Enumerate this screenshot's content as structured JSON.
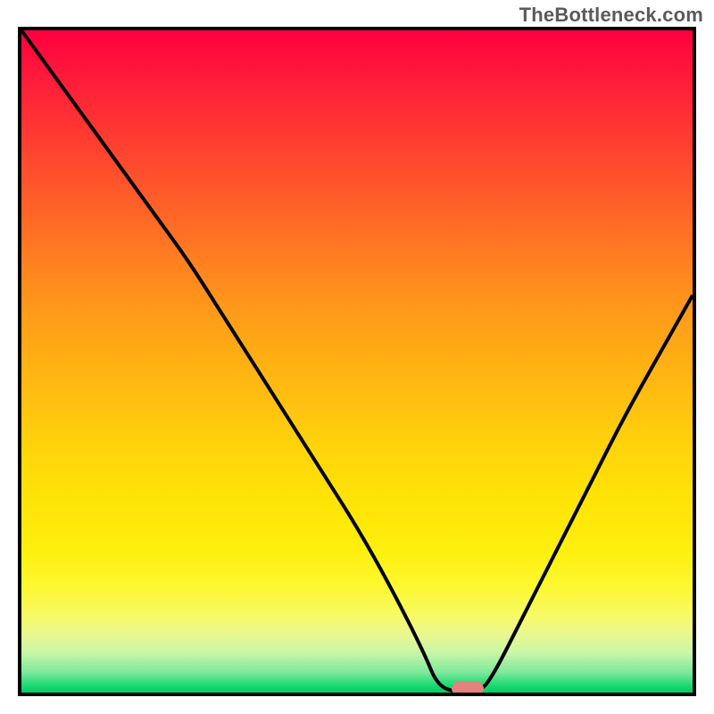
{
  "watermark": "TheBottleneck.com",
  "colors": {
    "frame_border": "#000000",
    "curve": "#000000",
    "marker": "#e5817f",
    "gradient_top": "#ff0040",
    "gradient_bottom": "#00cc66"
  },
  "chart_data": {
    "type": "line",
    "title": "",
    "xlabel": "",
    "ylabel": "",
    "xlim": [
      0,
      100
    ],
    "ylim": [
      0,
      100
    ],
    "x": [
      0,
      5,
      10,
      15,
      20,
      25,
      30,
      35,
      40,
      45,
      50,
      55,
      60,
      62,
      65,
      68,
      70,
      75,
      80,
      85,
      90,
      95,
      100
    ],
    "values": [
      100,
      93,
      86,
      79,
      72,
      65,
      57,
      49,
      41,
      33,
      25,
      16,
      6,
      1,
      0,
      0,
      2,
      12,
      22,
      32,
      42,
      51,
      60
    ],
    "marker": {
      "x": 66.5,
      "y": 0
    },
    "grid": false,
    "legend": null,
    "annotations": []
  }
}
